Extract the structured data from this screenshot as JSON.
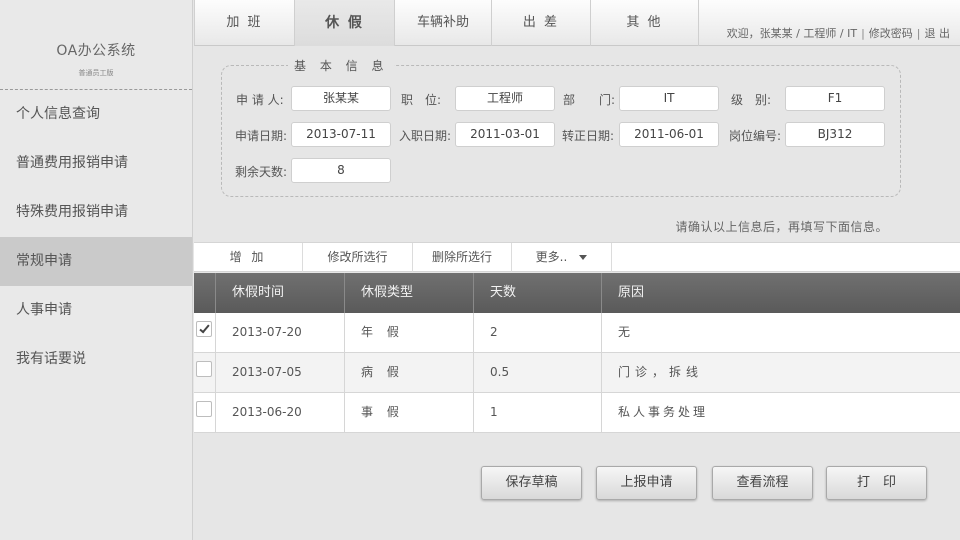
{
  "sidebar": {
    "brand_title": "OA办公系统",
    "brand_subtitle": "普通员工版",
    "items": [
      {
        "label": "个人信息查询"
      },
      {
        "label": "普通费用报销申请"
      },
      {
        "label": "特殊费用报销申请"
      },
      {
        "label": "常规申请"
      },
      {
        "label": "人事申请"
      },
      {
        "label": "我有话要说"
      }
    ]
  },
  "tabs": [
    "加 班",
    "休 假",
    "车辆补助",
    "出 差",
    "其 他"
  ],
  "header": {
    "welcome": "欢迎，张某某 / 工程师 / IT",
    "change_password": "修改密码",
    "logout": "退 出"
  },
  "basic_info": {
    "legend": "基 本 信 息",
    "applicant_label": "申 请 人:",
    "applicant": "张某某",
    "position_label": "职　位:",
    "position": "工程师",
    "department_label": "部　　门:",
    "department": "IT",
    "level_label": "级　别:",
    "level": "F1",
    "apply_date_label": "申请日期:",
    "apply_date": "2013-07-11",
    "hire_date_label": "入职日期:",
    "hire_date": "2011-03-01",
    "regular_date_label": "转正日期:",
    "regular_date": "2011-06-01",
    "post_no_label": "岗位编号:",
    "post_no": "BJ312",
    "remaining_days_label": "剩余天数:",
    "remaining_days": "8"
  },
  "confirm_note": "请确认以上信息后，再填写下面信息。",
  "toolbar": {
    "add": "增 加",
    "edit_selected": "修改所选行",
    "delete_selected": "删除所选行",
    "more": "更多.."
  },
  "table": {
    "headers": [
      "休假时间",
      "休假类型",
      "天数",
      "原因"
    ],
    "rows": [
      {
        "checked": true,
        "date": "2013-07-20",
        "type": "年 假",
        "days": "2",
        "reason": "无"
      },
      {
        "checked": false,
        "date": "2013-07-05",
        "type": "病 假",
        "days": "0.5",
        "reason": "门诊，拆线"
      },
      {
        "checked": false,
        "date": "2013-06-20",
        "type": "事 假",
        "days": "1",
        "reason": "私人事务处理"
      }
    ]
  },
  "actions": {
    "save_draft": "保存草稿",
    "submit": "上报申请",
    "view_flow": "查看流程",
    "print": "打　印"
  }
}
